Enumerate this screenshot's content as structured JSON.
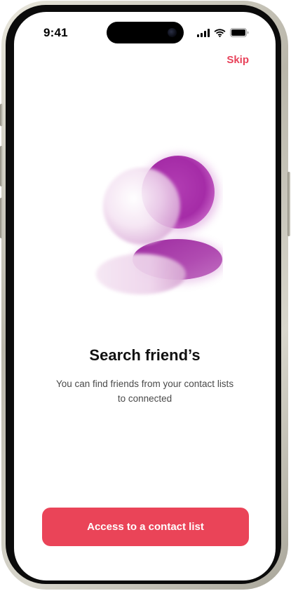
{
  "status_bar": {
    "time": "9:41",
    "icons": [
      "cellular-signal-icon",
      "wifi-icon",
      "battery-icon"
    ]
  },
  "header": {
    "skip_label": "Skip"
  },
  "onboarding": {
    "illustration": "blurred-pink-purple-discs",
    "title": "Search friend’s",
    "subtitle_line1": "You can find friends from your contact lists",
    "subtitle_line2": "to connected"
  },
  "actions": {
    "primary_label": "Access to a contact list"
  },
  "colors": {
    "accent": "#ea4458",
    "skip": "#e8425a",
    "illustration_purple": "#a12aa3",
    "illustration_light": "#f3e4f1"
  }
}
